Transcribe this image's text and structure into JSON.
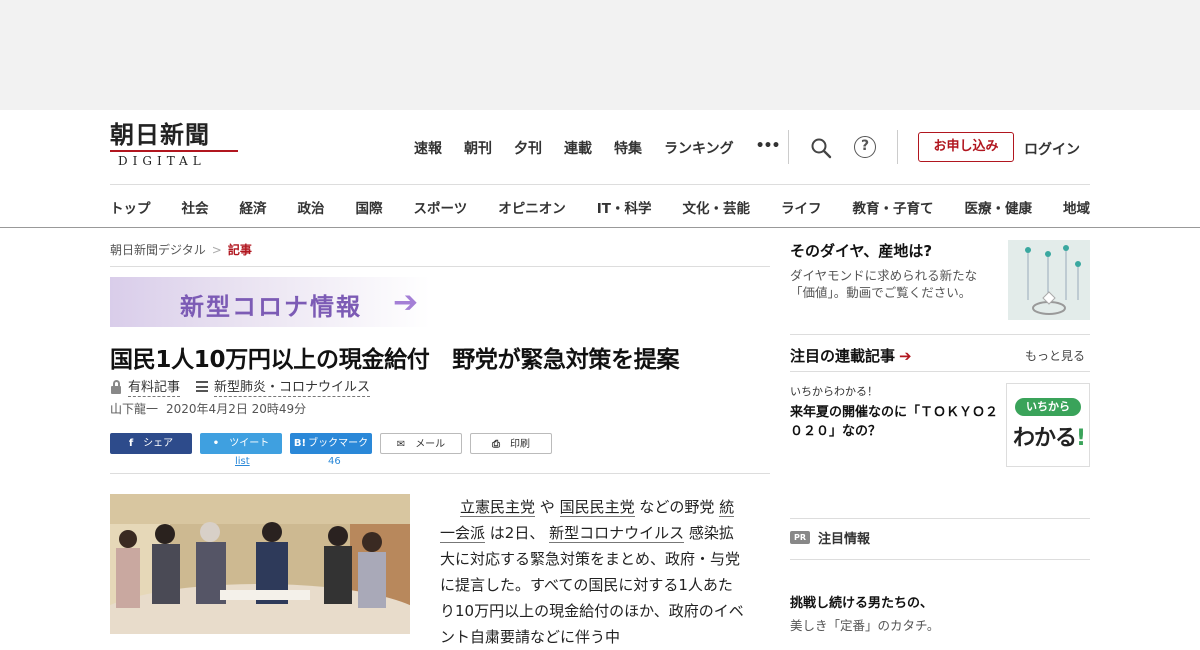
{
  "header": {
    "logo_main": "朝日新聞",
    "logo_sub": "DIGITAL",
    "top_nav": [
      "速報",
      "朝刊",
      "夕刊",
      "連載",
      "特集",
      "ランキング"
    ],
    "more_label": "•••",
    "help_label": "?",
    "apply_label": "お申し込み",
    "login_label": "ログイン"
  },
  "category_nav": [
    "トップ",
    "社会",
    "経済",
    "政治",
    "国際",
    "スポーツ",
    "オピニオン",
    "IT・科学",
    "文化・芸能",
    "ライフ",
    "教育・子育て",
    "医療・健康",
    "地域"
  ],
  "breadcrumb": {
    "home": "朝日新聞デジタル",
    "sep": ">",
    "current": "記事"
  },
  "banner": {
    "text": "新型コロナ情報",
    "arrow": "➔"
  },
  "article": {
    "headline": "国民1人10万円以上の現金給付　野党が緊急対策を提案",
    "paid_label": "有料記事",
    "topic_label": "新型肺炎・コロナウイルス",
    "author": "山下龍一",
    "date": "2020年4月2日 20時49分",
    "body_links": [
      "立憲民主党",
      "国民民主党",
      "統一会派",
      "新型コロナウイルス"
    ],
    "body_parts": [
      "や",
      "などの野党",
      "は2日、",
      "感染拡大に対応する緊急対策をまとめ、政府・与党に提言した。すべての国民に対する1人あたり10万円以上の現金給付のほか、政府のイベント自粛要請などに伴う中"
    ]
  },
  "share": {
    "facebook": "シェア",
    "twitter": "ツイート",
    "twitter_count": "list",
    "hatena": "ブックマーク",
    "hatena_count": "46",
    "mail": "メール",
    "print": "印刷",
    "fb_icon": "f",
    "hb_icon": "B!"
  },
  "sidebar": {
    "ad_title": "そのダイヤ、産地は?",
    "ad_desc": "ダイヤモンドに求められる新たな「価値」。動画でご覧ください。",
    "series_heading": "注目の連載記事",
    "series_arrow": "➔",
    "more_label": "もっと見る",
    "series_sub": "いちからわかる！",
    "series_title": "来年夏の開催なのに「ＴＯＫＹＯ２０２０」なの？",
    "wakaru_top": "いちから",
    "wakaru_main": "わかる",
    "wakaru_bang": "!",
    "pr_badge": "PR",
    "pr_heading": "注目情報",
    "pr_title": "挑戦し続ける男たちの、",
    "pr_desc": "美しき「定番」のカタチ。"
  }
}
